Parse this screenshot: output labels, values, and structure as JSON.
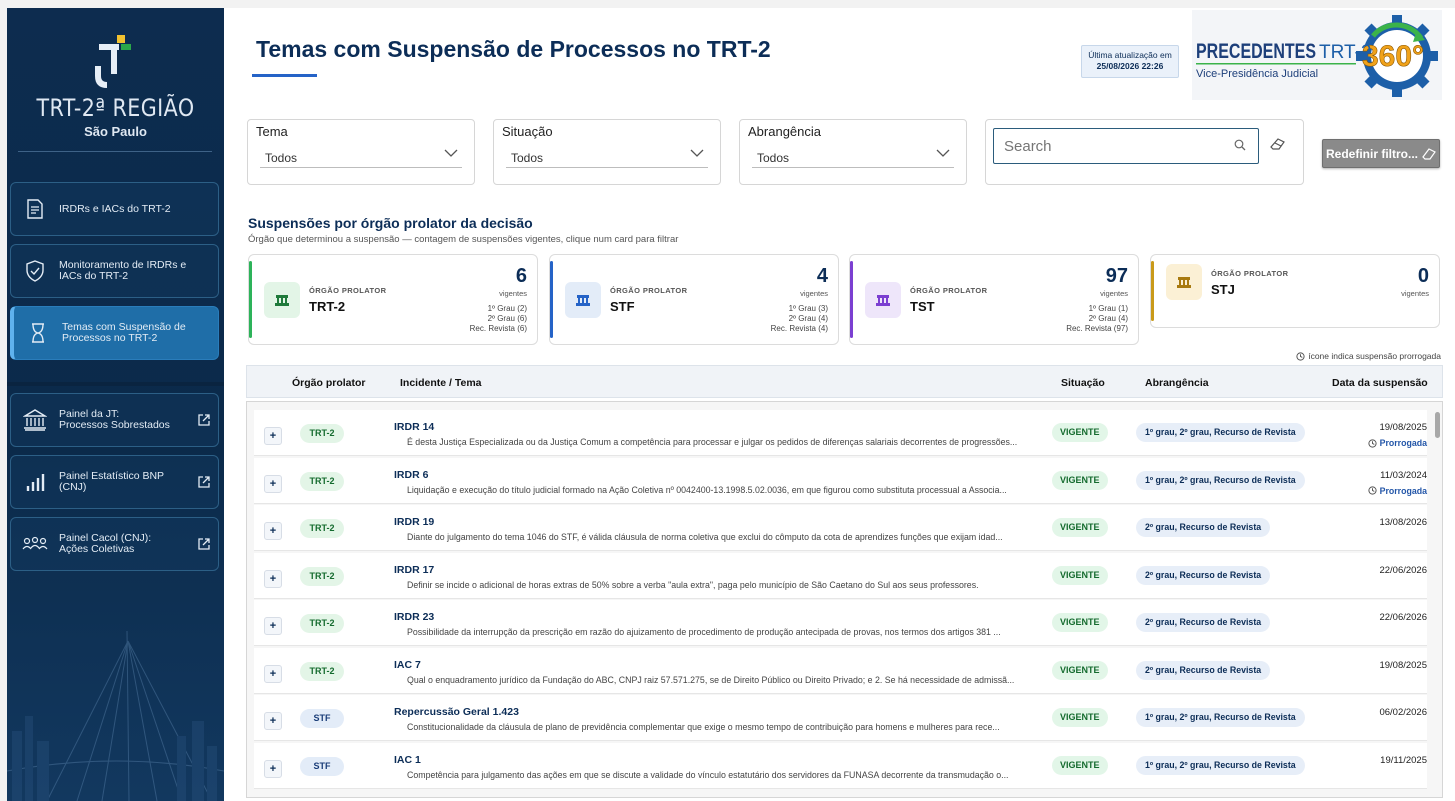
{
  "brand": {
    "line1": "TRT-2ª REGIÃO",
    "line2": "São Paulo"
  },
  "nav": [
    {
      "label": "IRDRs e IACs do TRT-2",
      "icon": "document-icon",
      "external": false
    },
    {
      "label": "Monitoramento de IRDRs e\nIACs do TRT-2",
      "icon": "shield-check-icon",
      "external": false
    },
    {
      "label": "Temas com Suspensão de\nProcessos no TRT-2",
      "icon": "hourglass-icon",
      "external": false,
      "active": true
    },
    {
      "label": "Painel da JT:\nProcessos Sobrestados",
      "icon": "courthouse-icon",
      "external": true
    },
    {
      "label": "Painel Estatístico BNP\n(CNJ)",
      "icon": "bar-chart-icon",
      "external": true
    },
    {
      "label": "Painel Cacol (CNJ):\nAções Coletivas",
      "icon": "group-icon",
      "external": true
    }
  ],
  "header": {
    "title": "Temas com Suspensão de Processos no TRT-2",
    "updated_label": "Última atualização em",
    "updated_value": "25/08/2026 22:26",
    "logo_text1": "PRECEDENTES",
    "logo_text2": "TRT-2",
    "logo_sub": "Vice-Presidência Judicial",
    "logo_badge": "360°"
  },
  "filters": {
    "tema": {
      "label": "Tema",
      "value": "Todos"
    },
    "situacao": {
      "label": "Situação",
      "value": "Todos"
    },
    "abrangencia": {
      "label": "Abrangência",
      "value": "Todos"
    },
    "search_placeholder": "Search",
    "reset_label": "Redefinir filtro..."
  },
  "section": {
    "title": "Suspensões por órgão prolator da decisão",
    "subtitle": "Órgão que determinou a suspensão — contagem de suspensões vigentes, clique num card para filtrar"
  },
  "cards": [
    {
      "kind": "ÓRGÃO PROLATOR",
      "name": "TRT-2",
      "count": "6",
      "vig": "vigentes",
      "details": [
        "1º Grau (2)",
        "2º Grau (6)",
        "Rec. Revista (6)"
      ],
      "color": "#2db35a",
      "bg": "#e3f5e7",
      "ico": "#1f7a3b"
    },
    {
      "kind": "ÓRGÃO PROLATOR",
      "name": "STF",
      "count": "4",
      "vig": "vigentes",
      "details": [
        "1º Grau (3)",
        "2º Grau (4)",
        "Rec. Revista (4)"
      ],
      "color": "#2563c7",
      "bg": "#e3ecf8",
      "ico": "#2563c7"
    },
    {
      "kind": "ÓRGÃO PROLATOR",
      "name": "TST",
      "count": "97",
      "vig": "vigentes",
      "details": [
        "1º Grau (1)",
        "2º Grau (4)",
        "Rec. Revista (97)"
      ],
      "color": "#7b3fd1",
      "bg": "#eee6fa",
      "ico": "#7b3fd1"
    },
    {
      "kind": "ÓRGÃO PROLATOR",
      "name": "STJ",
      "count": "0",
      "vig": "vigentes",
      "details": [],
      "color": "#c99a1a",
      "bg": "#fbf0d5",
      "ico": "#a87a10"
    }
  ],
  "legend_note": "ícone indica suspensão prorrogada",
  "table": {
    "headers": {
      "orgao": "Órgão prolator",
      "incidente": "Incidente / Tema",
      "situacao": "Situação",
      "abrangencia": "Abrangência",
      "data": "Data da suspensão"
    },
    "rows": [
      {
        "org": "TRT-2",
        "inc": "IRDR 14",
        "desc": "É desta Justiça Especializada ou da Justiça Comum a competência para processar e julgar os pedidos de diferenças salariais decorrentes de progressões...",
        "sit": "VIGENTE",
        "abr": "1º grau, 2º grau, Recurso de Revista",
        "date": "19/08/2025",
        "prorr": "Prorrogada"
      },
      {
        "org": "TRT-2",
        "inc": "IRDR 6",
        "desc": "Liquidação e execução do título judicial formado na Ação Coletiva nº 0042400-13.1998.5.02.0036, em que figurou como substituta processual a Associa...",
        "sit": "VIGENTE",
        "abr": "1º grau, 2º grau, Recurso de Revista",
        "date": "11/03/2024",
        "prorr": "Prorrogada"
      },
      {
        "org": "TRT-2",
        "inc": "IRDR 19",
        "desc": "Diante do julgamento do tema 1046 do STF, é válida cláusula de norma coletiva que exclui do cômputo da cota de aprendizes funções que exijam idad...",
        "sit": "VIGENTE",
        "abr": "2º grau, Recurso de Revista",
        "date": "13/08/2026",
        "prorr": ""
      },
      {
        "org": "TRT-2",
        "inc": "IRDR 17",
        "desc": "Definir se incide o adicional de horas extras de 50% sobre a verba \"aula extra\", paga pelo município de São Caetano do Sul aos seus professores.",
        "sit": "VIGENTE",
        "abr": "2º grau, Recurso de Revista",
        "date": "22/06/2026",
        "prorr": ""
      },
      {
        "org": "TRT-2",
        "inc": "IRDR 23",
        "desc": "Possibilidade da interrupção da prescrição em razão do ajuizamento de procedimento de produção antecipada de provas, nos termos dos artigos 381 ...",
        "sit": "VIGENTE",
        "abr": "2º grau, Recurso de Revista",
        "date": "22/06/2026",
        "prorr": ""
      },
      {
        "org": "TRT-2",
        "inc": "IAC 7",
        "desc": "Qual o enquadramento jurídico da Fundação do ABC, CNPJ raiz 57.571.275, se de Direito Público ou Direito Privado; e 2. Se há necessidade de admissã...",
        "sit": "VIGENTE",
        "abr": "2º grau, Recurso de Revista",
        "date": "19/08/2025",
        "prorr": ""
      },
      {
        "org": "STF",
        "inc": "Repercussão Geral 1.423",
        "desc": "Constitucionalidade da cláusula de plano de previdência complementar que exige o mesmo tempo de contribuição para homens e mulheres para rece...",
        "sit": "VIGENTE",
        "abr": "1º grau, 2º grau, Recurso de Revista",
        "date": "06/02/2026",
        "prorr": ""
      },
      {
        "org": "STF",
        "inc": "IAC 1",
        "desc": "Competência para julgamento das ações em que se discute a validade do vínculo estatutário dos servidores da FUNASA decorrente da transmudação o...",
        "sit": "VIGENTE",
        "abr": "1º grau, 2º grau, Recurso de Revista",
        "date": "19/11/2025",
        "prorr": ""
      }
    ]
  }
}
